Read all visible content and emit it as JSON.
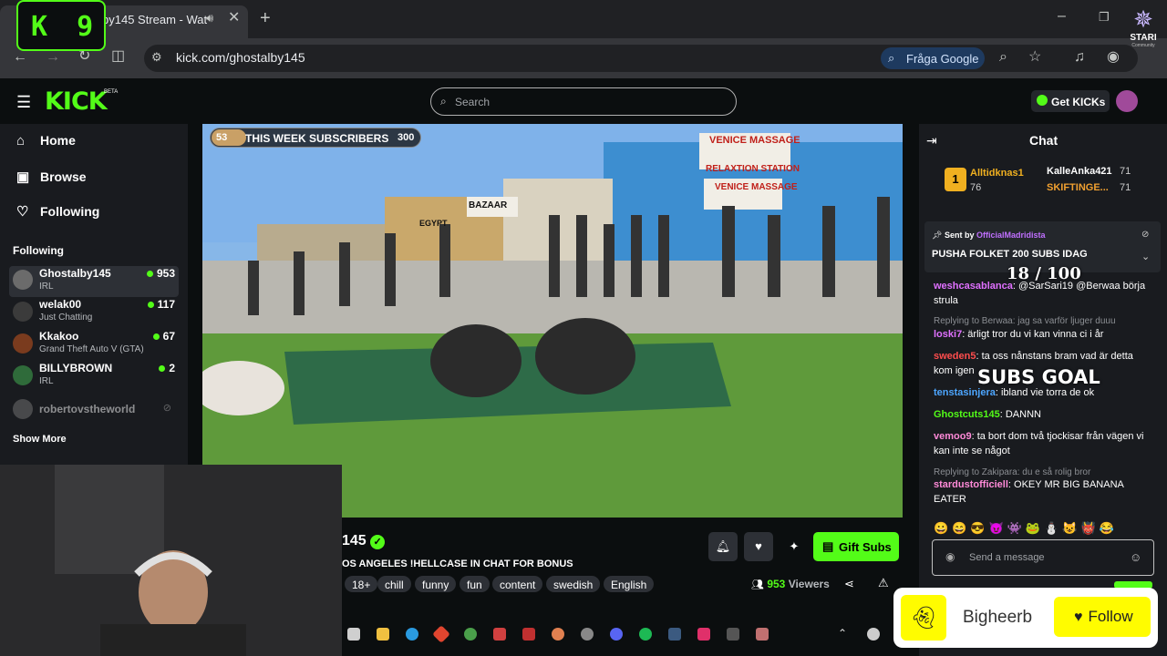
{
  "browser": {
    "tab_title": "by145 Stream - Wat",
    "url": "kick.com/ghostalby145",
    "google_button": "Fråga Google"
  },
  "overlay": {
    "kick_counter_letter": "K",
    "kick_counter_value": "9",
    "stari_label": "STARI",
    "stari_sub": "Community"
  },
  "header": {
    "logo": "KICK",
    "beta": "BETA",
    "search_placeholder": "Search",
    "get_kicks": "Get KICKs"
  },
  "sidebar": {
    "nav": [
      {
        "label": "Home"
      },
      {
        "label": "Browse"
      },
      {
        "label": "Following"
      }
    ],
    "following_header": "Following",
    "following": [
      {
        "name": "Ghostalby145",
        "category": "IRL",
        "viewers": "953"
      },
      {
        "name": "welak00",
        "category": "Just Chatting",
        "viewers": "117"
      },
      {
        "name": "Kkakoo",
        "category": "Grand Theft Auto V (GTA)",
        "viewers": "67"
      },
      {
        "name": "BILLYBROWN",
        "category": "IRL",
        "viewers": "2"
      },
      {
        "name": "robertovstheworld",
        "category": "",
        "viewers": ""
      }
    ],
    "show_more": "Show More"
  },
  "video": {
    "sub_count": "53",
    "sub_label": "THIS WEEK SUBSCRIBERS",
    "sub_goal": "300",
    "signs": [
      "VENICE MASSAGE",
      "RELAXTION STATION",
      "VENICE MASSAGE",
      "EGYPT",
      "BAZAAR"
    ]
  },
  "stream_info": {
    "channel_fragment": "145",
    "title": "OS ANGELES !HELLCASE IN CHAT FOR BONUS",
    "tags": [
      "18+",
      "chill",
      "funny",
      "fun",
      "content",
      "swedish",
      "English"
    ],
    "viewers": "953",
    "viewers_label": "Viewers",
    "gift_subs": "Gift Subs"
  },
  "chat": {
    "title": "Chat",
    "leaders": [
      {
        "rank": "1",
        "name": "Alltidknas1",
        "count": "76"
      },
      {
        "name": "KalleAnka421",
        "count": "71"
      },
      {
        "name": "SKIFTINGE...",
        "count": "71"
      }
    ],
    "pinned_sent_by": "Sent by",
    "pinned_user": "OfficialMadridista",
    "pinned_text": "PUSHA FOLKET 200 SUBS IDAG",
    "goal_value": "18 / 100",
    "goal_label": "SUBS GOAL",
    "messages": [
      {
        "user": "weshcasablanca",
        "color": "#e070ff",
        "text": ": @SarSari19 @Berwaa börja strula"
      },
      {
        "reply": "Replying to Berwaa: jag sa varför ljuger duuu",
        "user": "loski7",
        "color": "#e070ff",
        "text": ": ärligt tror du vi kan vinna ci i år"
      },
      {
        "user": "sweden5",
        "color": "#ff4d4d",
        "text": ": ta oss nånstans bram vad är detta kom igen"
      },
      {
        "user": "tenstasinjera",
        "color": "#4da6ff",
        "text": ": ibland vie torra de ok"
      },
      {
        "user": "Ghostcuts145",
        "color": "#53fc18",
        "text": ": DANNN"
      },
      {
        "user": "vemoo9",
        "color": "#ff8ad8",
        "text": ": ta bort dom två tjockisar från vägen vi kan inte se något"
      },
      {
        "reply": "Replying to Zakipara: du e så rolig bror",
        "user": "stardustofficiell",
        "color": "#ff8ad8",
        "text": ": OKEY MR BIG BANANA EATER"
      }
    ],
    "input_placeholder": "Send a message"
  },
  "follow_popup": {
    "name": "Bigheerb",
    "button": "Follow"
  },
  "colors": {
    "kick_green": "#53fc18",
    "bg": "#0b0e0f",
    "sidebar": "#191b1f",
    "snap_yellow": "#fffc00"
  }
}
